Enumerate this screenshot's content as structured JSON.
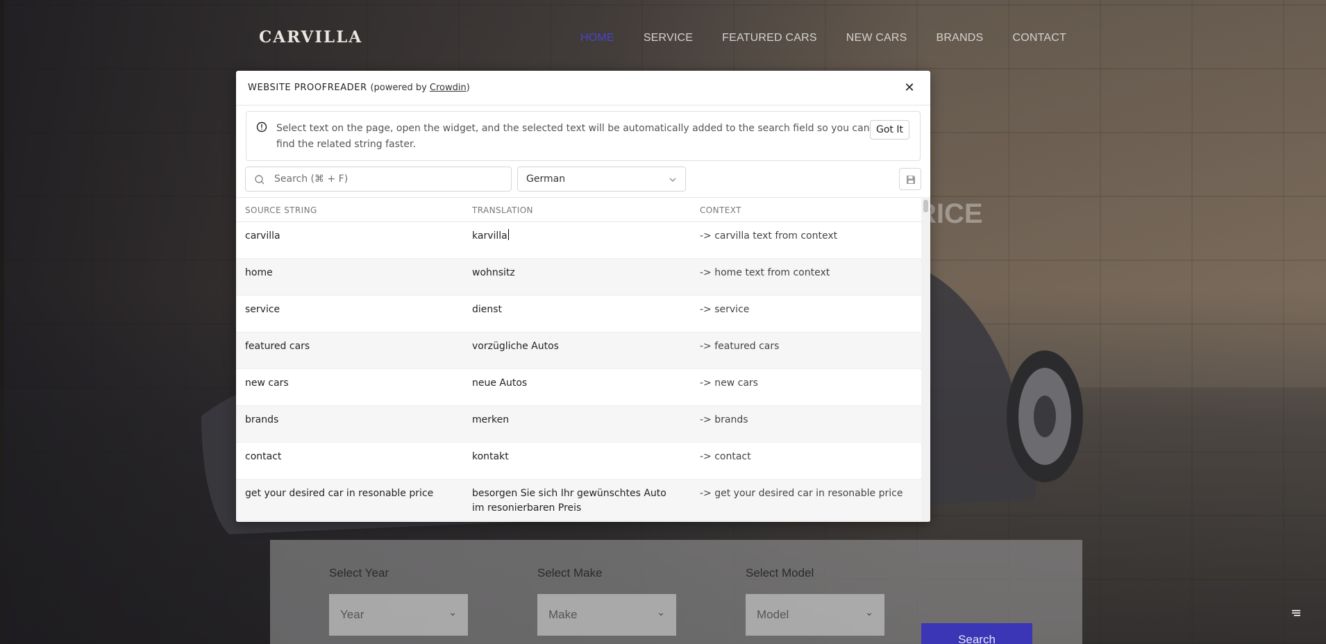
{
  "site": {
    "logo": "CARVILLA",
    "nav": [
      "HOME",
      "SERVICE",
      "FEATURED CARS",
      "NEW CARS",
      "BRANDS",
      "CONTACT"
    ],
    "hero_fragment": "RICE",
    "search_panel": {
      "year_label": "Select Year",
      "make_label": "Select Make",
      "model_label": "Select Model",
      "year_value": "Year",
      "make_value": "Make",
      "model_value": "Model",
      "button": "Search"
    },
    "accent_color": "#4a44c9"
  },
  "modal": {
    "title": "WEBSITE PROOFREADER",
    "powered_prefix": "(powered by ",
    "powered_link": "Crowdin",
    "powered_suffix": ")",
    "close_icon": "close-icon",
    "info_text": "Select text on the page, open the widget, and the selected text will be automatically added to the search field so you can find the related string faster.",
    "got_it": "Got It",
    "search_placeholder": "Search (⌘ + F)",
    "language": "German",
    "columns": [
      "SOURCE STRING",
      "TRANSLATION",
      "CONTEXT"
    ],
    "rows": [
      {
        "source": "carvilla",
        "translation": "karvilla",
        "context": "-> carvilla text from context"
      },
      {
        "source": "home",
        "translation": "wohnsitz",
        "context": "-> home text from context"
      },
      {
        "source": "service",
        "translation": "dienst",
        "context": "-> service"
      },
      {
        "source": "featured cars",
        "translation": "vorzügliche Autos",
        "context": "-> featured cars"
      },
      {
        "source": "new cars",
        "translation": "neue Autos",
        "context": "-> new cars"
      },
      {
        "source": "brands",
        "translation": "merken",
        "context": "-> brands"
      },
      {
        "source": "contact",
        "translation": "kontakt",
        "context": "-> contact"
      },
      {
        "source": "get your desired car in resonable price",
        "translation": "besorgen Sie sich Ihr gewünschtes Auto im resonierbaren Preis",
        "context": "-> get your desired car in resonable price"
      }
    ]
  }
}
